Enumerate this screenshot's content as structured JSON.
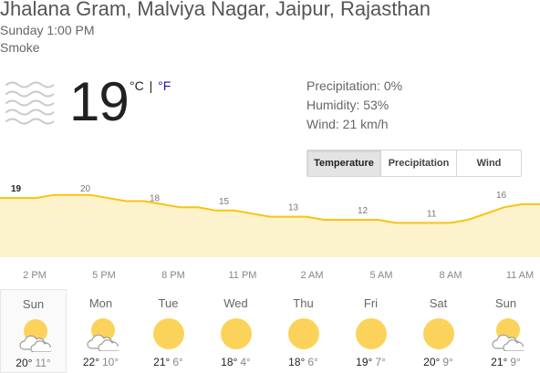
{
  "header": {
    "location": "Jhalana Gram, Malviya Nagar, Jaipur, Rajasthan",
    "datetime": "Sunday 1:00 PM",
    "condition": "Smoke"
  },
  "current": {
    "temperature": "19",
    "unit_c": "°C",
    "unit_sep": "|",
    "unit_f": "°F",
    "icon": "smoke-icon"
  },
  "details": {
    "precipitation": "Precipitation: 0%",
    "humidity": "Humidity: 53%",
    "wind": "Wind: 21 km/h"
  },
  "tabs": [
    {
      "label": "Temperature",
      "active": true
    },
    {
      "label": "Precipitation",
      "active": false
    },
    {
      "label": "Wind",
      "active": false
    }
  ],
  "chart_data": {
    "type": "area",
    "x": [
      "2 PM",
      "5 PM",
      "8 PM",
      "11 PM",
      "2 AM",
      "5 AM",
      "8 AM",
      "11 AM"
    ],
    "labeled_values": [
      19,
      20,
      18,
      15,
      13,
      12,
      11,
      16
    ],
    "hourly_values": [
      19,
      19,
      19,
      20,
      20,
      20,
      19,
      18,
      18,
      17,
      16,
      16,
      15,
      15,
      14,
      13,
      13,
      13,
      12,
      12,
      12,
      12,
      11,
      11,
      11,
      11,
      12,
      14,
      16,
      17,
      17
    ],
    "ylim": [
      0,
      24
    ],
    "line_color": "#f9c40f",
    "fill_color": "#fcf2cc"
  },
  "forecast": [
    {
      "day": "Sun",
      "high": "20°",
      "low": "11°",
      "icon": "partly-cloudy-icon",
      "selected": true
    },
    {
      "day": "Mon",
      "high": "22°",
      "low": "10°",
      "icon": "partly-cloudy-icon",
      "selected": false
    },
    {
      "day": "Tue",
      "high": "21°",
      "low": "6°",
      "icon": "sun-icon",
      "selected": false
    },
    {
      "day": "Wed",
      "high": "18°",
      "low": "4°",
      "icon": "sun-icon",
      "selected": false
    },
    {
      "day": "Thu",
      "high": "18°",
      "low": "6°",
      "icon": "sun-icon",
      "selected": false
    },
    {
      "day": "Fri",
      "high": "19°",
      "low": "7°",
      "icon": "sun-icon",
      "selected": false
    },
    {
      "day": "Sat",
      "high": "20°",
      "low": "9°",
      "icon": "sun-icon",
      "selected": false
    },
    {
      "day": "Sun",
      "high": "21°",
      "low": "9°",
      "icon": "partly-cloudy-icon",
      "selected": false
    }
  ]
}
